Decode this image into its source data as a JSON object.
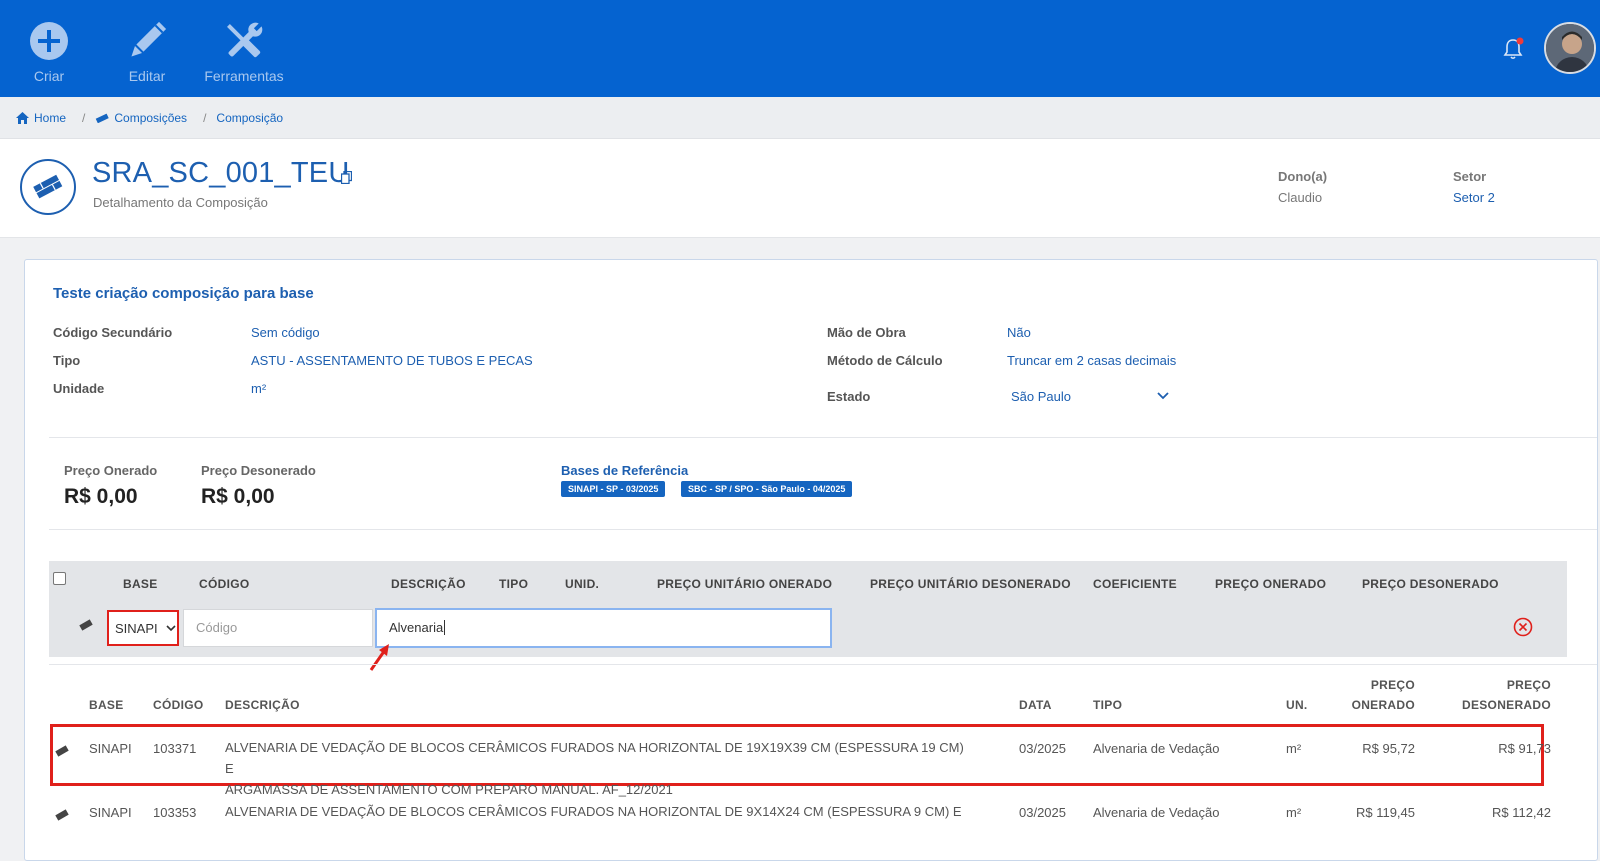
{
  "toolbar": {
    "create_label": "Criar",
    "edit_label": "Editar",
    "tools_label": "Ferramentas"
  },
  "breadcrumb": {
    "home": "Home",
    "compositions": "Composições",
    "composition": "Composição",
    "separator": "/"
  },
  "header": {
    "title": "SRA_SC_001_TEU",
    "subtitle": "Detalhamento da Composição",
    "owner_label": "Dono(a)",
    "owner_value": "Claudio",
    "sector_label": "Setor",
    "sector_value": "Setor 2"
  },
  "card": {
    "title": "Teste criação composição para base",
    "fields": {
      "secondary_code_label": "Código Secundário",
      "secondary_code_value": "Sem código",
      "type_label": "Tipo",
      "type_value": "ASTU - ASSENTAMENTO DE TUBOS E PECAS",
      "unit_label": "Unidade",
      "unit_value": "m²",
      "labor_label": "Mão de Obra",
      "labor_value": "Não",
      "calc_label": "Método de Cálculo",
      "calc_value": "Truncar em 2 casas decimais",
      "state_label": "Estado",
      "state_value": "São Paulo"
    },
    "prices": {
      "onerado_label": "Preço Onerado",
      "onerado_value": "R$ 0,00",
      "desonerado_label": "Preço Desonerado",
      "desonerado_value": "R$ 0,00"
    },
    "bases": {
      "title": "Bases de Referência",
      "tags": [
        "SINAPI - SP - 03/2025",
        "SBC - SP / SPO - São Paulo - 04/2025"
      ]
    }
  },
  "grid": {
    "headers": {
      "base": "BASE",
      "code": "CÓDIGO",
      "description": "DESCRIÇÃO",
      "type": "TIPO",
      "unit": "UNID.",
      "unit_price_onerado": "PREÇO UNITÁRIO ONERADO",
      "unit_price_desonerado": "PREÇO UNITÁRIO DESONERADO",
      "coefficient": "COEFICIENTE",
      "price_onerado": "PREÇO ONERADO",
      "price_desonerado": "PREÇO DESONERADO"
    },
    "new_row": {
      "base_selected": "SINAPI",
      "code_placeholder": "Código",
      "description_value": "Alvenaria"
    }
  },
  "results": {
    "headers": {
      "base": "BASE",
      "code": "CÓDIGO",
      "description": "DESCRIÇÃO",
      "date": "DATA",
      "type": "TIPO",
      "unit": "UN.",
      "onerado_l1": "PREÇO",
      "onerado_l2": "ONERADO",
      "desonerado_l1": "PREÇO",
      "desonerado_l2": "DESONERADO"
    },
    "rows": [
      {
        "base": "SINAPI",
        "code": "103371",
        "desc_l1": "ALVENARIA DE VEDAÇÃO DE BLOCOS CERÂMICOS FURADOS NA HORIZONTAL DE 19X19X39 CM (ESPESSURA 19 CM) E",
        "desc_l2": "ARGAMASSA DE ASSENTAMENTO COM PREPARO MANUAL. AF_12/2021",
        "date": "03/2025",
        "type": "Alvenaria de Vedação",
        "unit": "m²",
        "onerado": "R$ 95,72",
        "desonerado": "R$ 91,73"
      },
      {
        "base": "SINAPI",
        "code": "103353",
        "desc_l1": "ALVENARIA DE VEDAÇÃO DE BLOCOS CERÂMICOS FURADOS NA HORIZONTAL DE 9X14X24 CM (ESPESSURA 9 CM) E",
        "desc_l2": "",
        "date": "03/2025",
        "type": "Alvenaria de Vedação",
        "unit": "m²",
        "onerado": "R$ 119,45",
        "desonerado": "R$ 112,42"
      }
    ]
  },
  "colors": {
    "topbar": "#0563d0",
    "accent": "#1d5fb0",
    "highlight": "#e0201b"
  }
}
